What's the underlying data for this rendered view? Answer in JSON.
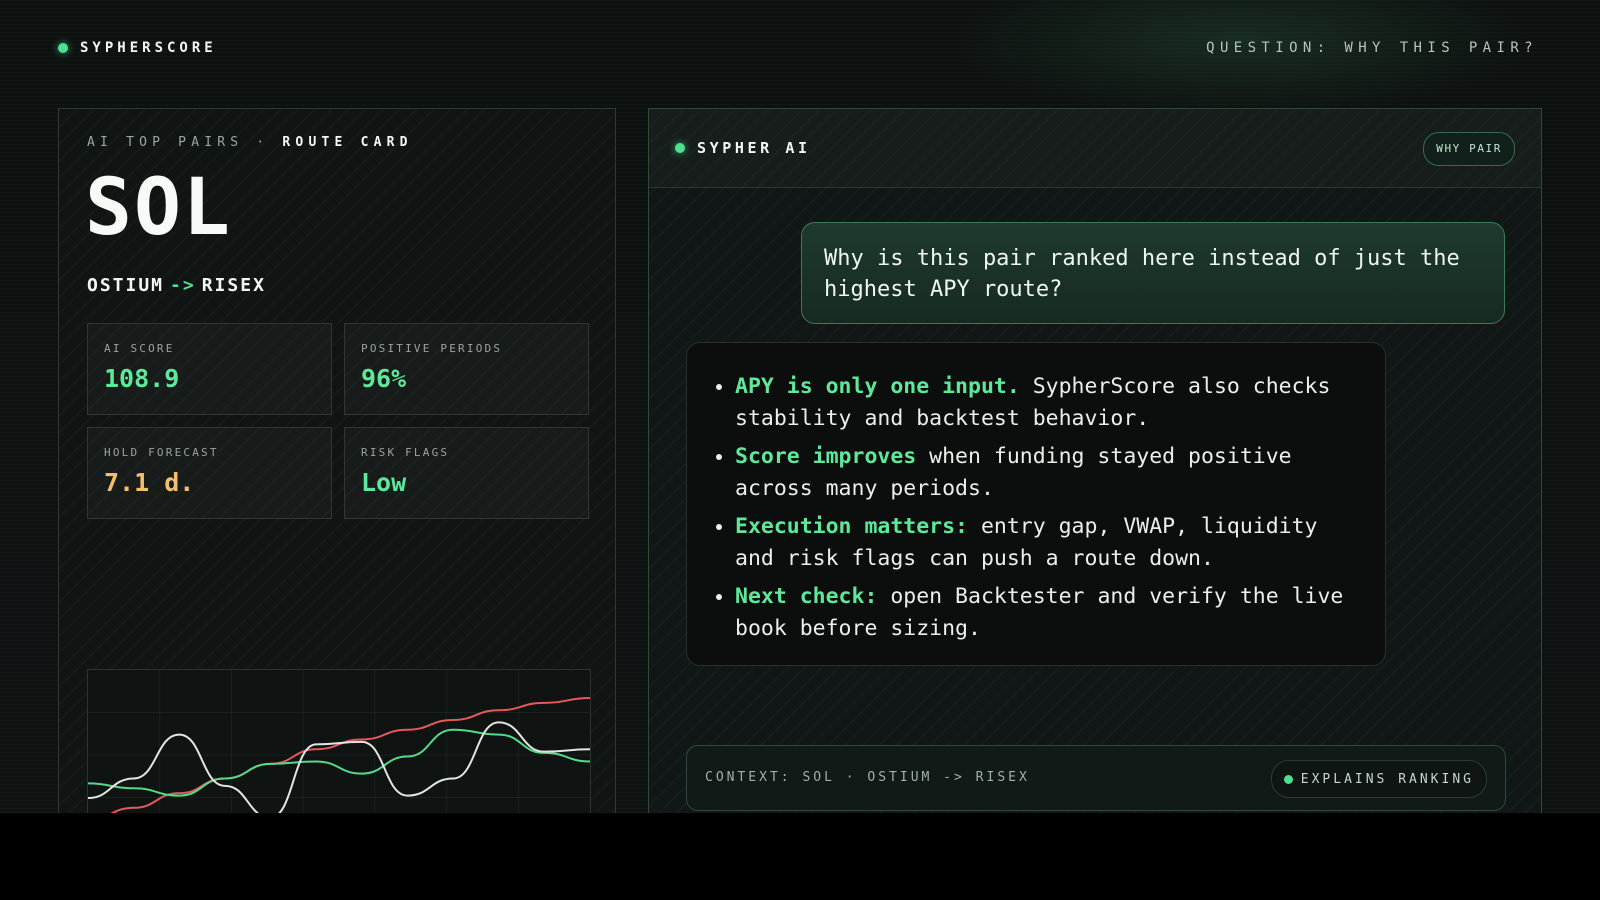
{
  "header": {
    "brand": "SYPHERSCORE",
    "question": "QUESTION: WHY THIS PAIR?"
  },
  "route_card": {
    "eyebrow_prefix": "AI TOP PAIRS · ",
    "eyebrow_emphasis": "ROUTE CARD",
    "asset": "SOL",
    "route_from": "OSTIUM",
    "route_arrow": "->",
    "route_to": "RISEX",
    "stats": [
      {
        "label": "AI SCORE",
        "value": "108.9",
        "color": "#5ee89a"
      },
      {
        "label": "POSITIVE PERIODS",
        "value": "96%",
        "color": "#5ee89a"
      },
      {
        "label": "HOLD FORECAST",
        "value": "7.1 d.",
        "color": "#f2bf6e"
      },
      {
        "label": "RISK FLAGS",
        "value": "Low",
        "color": "#5ee89a"
      }
    ]
  },
  "chart_data": {
    "type": "line",
    "series": [
      {
        "color": "#e25a5a",
        "values": [
          0.0,
          0.1,
          0.22,
          0.34,
          0.46,
          0.58,
          0.66,
          0.74,
          0.82,
          0.9,
          0.96,
          1.0
        ]
      },
      {
        "color": "#56d98a",
        "values": [
          0.3,
          0.26,
          0.2,
          0.34,
          0.46,
          0.48,
          0.38,
          0.52,
          0.74,
          0.7,
          0.55,
          0.48
        ]
      },
      {
        "color": "#e4e4e4",
        "values": [
          0.18,
          0.34,
          0.7,
          0.28,
          0.02,
          0.62,
          0.64,
          0.2,
          0.34,
          0.8,
          0.56,
          0.58
        ]
      }
    ],
    "ylim": [
      0,
      1
    ],
    "grid": true
  },
  "assistant": {
    "title": "SYPHER AI",
    "badge": "WHY PAIR",
    "user_message": "Why is this pair ranked here instead of just the highest APY route?",
    "bullets": [
      {
        "lead": "APY is only one input.",
        "text": " SypherScore also checks stability and backtest behavior."
      },
      {
        "lead": "Score improves",
        "text": " when funding stayed positive across many periods."
      },
      {
        "lead": "Execution matters:",
        "text": " entry gap, VWAP, liquidity and risk flags can push a route down."
      },
      {
        "lead": "Next check:",
        "text": " open Backtester and verify the live book before sizing."
      }
    ],
    "context": "CONTEXT: SOL · OSTIUM -> RISEX",
    "context_badge": "EXPLAINS RANKING"
  },
  "colors": {
    "accent": "#4ee08f",
    "warning": "#f2bf6e"
  }
}
